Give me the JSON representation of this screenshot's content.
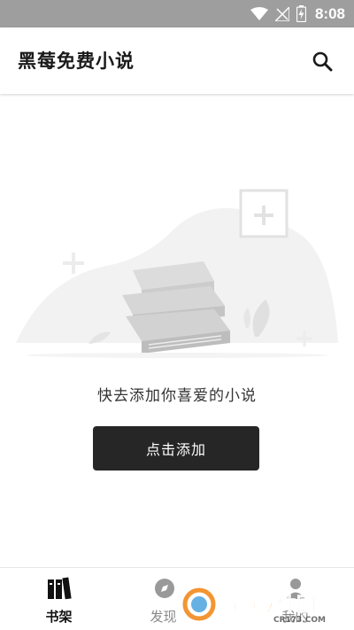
{
  "status_bar": {
    "time": "8:08",
    "bg_color": "#9e9e9e",
    "icons": [
      "wifi-icon",
      "signal-off-icon",
      "battery-charging-icon"
    ]
  },
  "app_bar": {
    "title": "黑莓免费小说",
    "search_icon": "search-icon"
  },
  "empty_state": {
    "message": "快去添加你喜爱的小说",
    "button_label": "点击添加",
    "button_color": "#262626"
  },
  "bottom_nav": {
    "items": [
      {
        "label": "书架",
        "icon": "bookshelf-icon",
        "active": true
      },
      {
        "label": "发现",
        "icon": "discover-icon",
        "active": false
      },
      {
        "label": "我的",
        "icon": "profile-icon",
        "active": false
      }
    ]
  },
  "watermark": {
    "text_main": "西西软件园",
    "text_sub": "CR173.COM"
  }
}
